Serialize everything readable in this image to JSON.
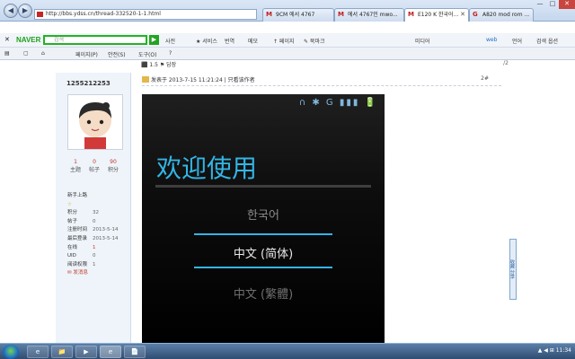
{
  "browser": {
    "url": "http://bbs.ydss.cn/thread-332520-1-1.html",
    "tabs": [
      {
        "label": "9CM 에서 4767",
        "icon": "M"
      },
      {
        "label": "에서 4767인 ...",
        "icon": "M"
      },
      {
        "label": "에서 4767인 mwo...",
        "icon": "M"
      },
      {
        "label": "E120 K 한국어...",
        "icon": "M",
        "active": true
      },
      {
        "label": "A820 mod rom ...",
        "icon": "G"
      }
    ],
    "window_controls": {
      "min": "—",
      "max": "□",
      "close": "✕"
    }
  },
  "naver": {
    "logo": "NAVER",
    "search_placeholder": "검색",
    "search_button": "▶",
    "items": [
      "사전",
      "★ 서비스",
      "번역",
      "메모",
      "↑ 페이지",
      "✎ 북마크"
    ],
    "right_items": [
      "미디어",
      "web",
      "언어",
      "검색 옵션"
    ]
  },
  "commandbar": {
    "items": [
      "▤",
      "▢",
      "⌂",
      "페이지(P)",
      "안전(S)",
      "도구(O)",
      "?"
    ]
  },
  "post": {
    "top_row": "⬛ 1.5 ⚑ 답장",
    "top_row_right": "/2",
    "username": "1255212253",
    "header": "发表于 2013-7-15 11:21:24  |  只看该作者",
    "post_number": "2#",
    "stats": [
      {
        "value": "1",
        "label": "主题"
      },
      {
        "value": "0",
        "label": "帖子"
      },
      {
        "value": "90",
        "label": "积分"
      }
    ],
    "info": [
      {
        "key": "新手上路",
        "value": ""
      },
      {
        "key": "☆",
        "value": ""
      },
      {
        "key": "积分",
        "value": "32"
      },
      {
        "key": "帖子",
        "value": "0"
      },
      {
        "key": "注册时间",
        "value": "2013-5-14"
      },
      {
        "key": "最后登录",
        "value": "2013-5-14"
      },
      {
        "key": "在线",
        "value": "1"
      },
      {
        "key": "UID",
        "value": "0"
      },
      {
        "key": "阅读权限",
        "value": "1"
      }
    ],
    "send_message": "✉ 发消息"
  },
  "phone": {
    "status_icons": "∩ ✱ G ▮▮▮ 🔋",
    "welcome": "欢迎使用",
    "languages": [
      "한국어",
      "中文 (简体)",
      "中文 (繁體)"
    ],
    "accent": "#33b5e5"
  },
  "right_widget": "收藏 分享",
  "taskbar": {
    "buttons": [
      "e",
      "📁",
      "▶",
      "e",
      "📄"
    ],
    "tray": "▲ ◀ ⊞ 11:34"
  }
}
